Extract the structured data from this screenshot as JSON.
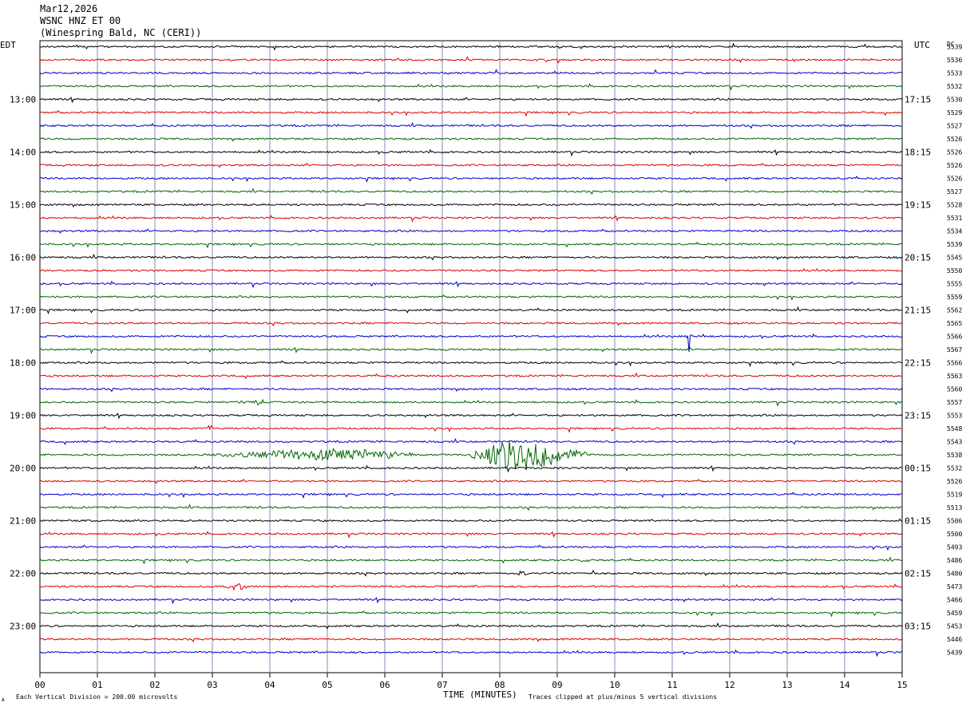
{
  "header": {
    "date": "Mar12,2026",
    "station": "WSNC HNZ ET 00",
    "location": "(Winespring Bald, NC (CERI))"
  },
  "labels": {
    "left_tz": "EDT",
    "right_tz": "UTC",
    "dc": "DC",
    "xlabel": "TIME (MINUTES)",
    "scale_note": "Each Vertical Division =  200.00 microvolts",
    "clip_note": "Traces clipped at plus/minus 5 vertical divisions",
    "corner_mark": "A"
  },
  "chart_data": {
    "type": "line",
    "title": "WSNC HNZ ET 00",
    "xlabel": "TIME (MINUTES)",
    "xlim": [
      0,
      15
    ],
    "x_ticks": [
      "00",
      "01",
      "02",
      "03",
      "04",
      "05",
      "06",
      "07",
      "08",
      "09",
      "10",
      "11",
      "12",
      "13",
      "14",
      "15"
    ],
    "trace_colors": [
      "#000000",
      "#dd0000",
      "#0000cc",
      "#006600"
    ],
    "grid": true,
    "left_hour_labels": [
      "13:00",
      "14:00",
      "15:00",
      "16:00",
      "17:00",
      "18:00",
      "19:00",
      "20:00",
      "21:00",
      "22:00",
      "23:00"
    ],
    "right_hour_labels": [
      "17:15",
      "18:15",
      "19:15",
      "20:15",
      "21:15",
      "22:15",
      "23:15",
      "00:15",
      "01:15",
      "02:15",
      "03:15"
    ],
    "dc_offsets": [
      "5539",
      "5536",
      "5533",
      "5532",
      "5530",
      "5529",
      "5527",
      "5526",
      "5526",
      "5526",
      "5526",
      "5527",
      "5528",
      "5531",
      "5534",
      "5539",
      "5545",
      "5550",
      "5555",
      "5559",
      "5562",
      "5565",
      "5566",
      "5567",
      "5566",
      "5563",
      "5560",
      "5557",
      "5553",
      "5548",
      "5543",
      "5538",
      "5532",
      "5526",
      "5519",
      "5513",
      "5506",
      "5500",
      "5493",
      "5486",
      "5480",
      "5473",
      "5466",
      "5459",
      "5453",
      "5446",
      "5439"
    ],
    "events": [
      {
        "trace": 31,
        "start_min": 3.0,
        "end_min": 6.5,
        "peak_min": 5.0,
        "amplitude": 0.45
      },
      {
        "trace": 31,
        "start_min": 7.5,
        "end_min": 9.5,
        "peak_min": 8.4,
        "amplitude": 1.3
      },
      {
        "trace": 22,
        "start_min": 11.25,
        "end_min": 11.35,
        "peak_min": 11.3,
        "amplitude": 1.5
      },
      {
        "trace": 27,
        "start_min": 3.0,
        "end_min": 3.9,
        "peak_min": 3.8,
        "amplitude": 0.2
      },
      {
        "trace": 29,
        "start_min": 2.9,
        "end_min": 3.1,
        "peak_min": 2.95,
        "amplitude": 0.25
      },
      {
        "trace": 41,
        "start_min": 3.2,
        "end_min": 3.6,
        "peak_min": 3.45,
        "amplitude": 0.3
      },
      {
        "trace": 39,
        "start_min": 9.4,
        "end_min": 9.6,
        "peak_min": 9.5,
        "amplitude": 0.2
      },
      {
        "trace": 40,
        "start_min": 8.3,
        "end_min": 8.5,
        "peak_min": 8.4,
        "amplitude": 0.2
      }
    ]
  }
}
